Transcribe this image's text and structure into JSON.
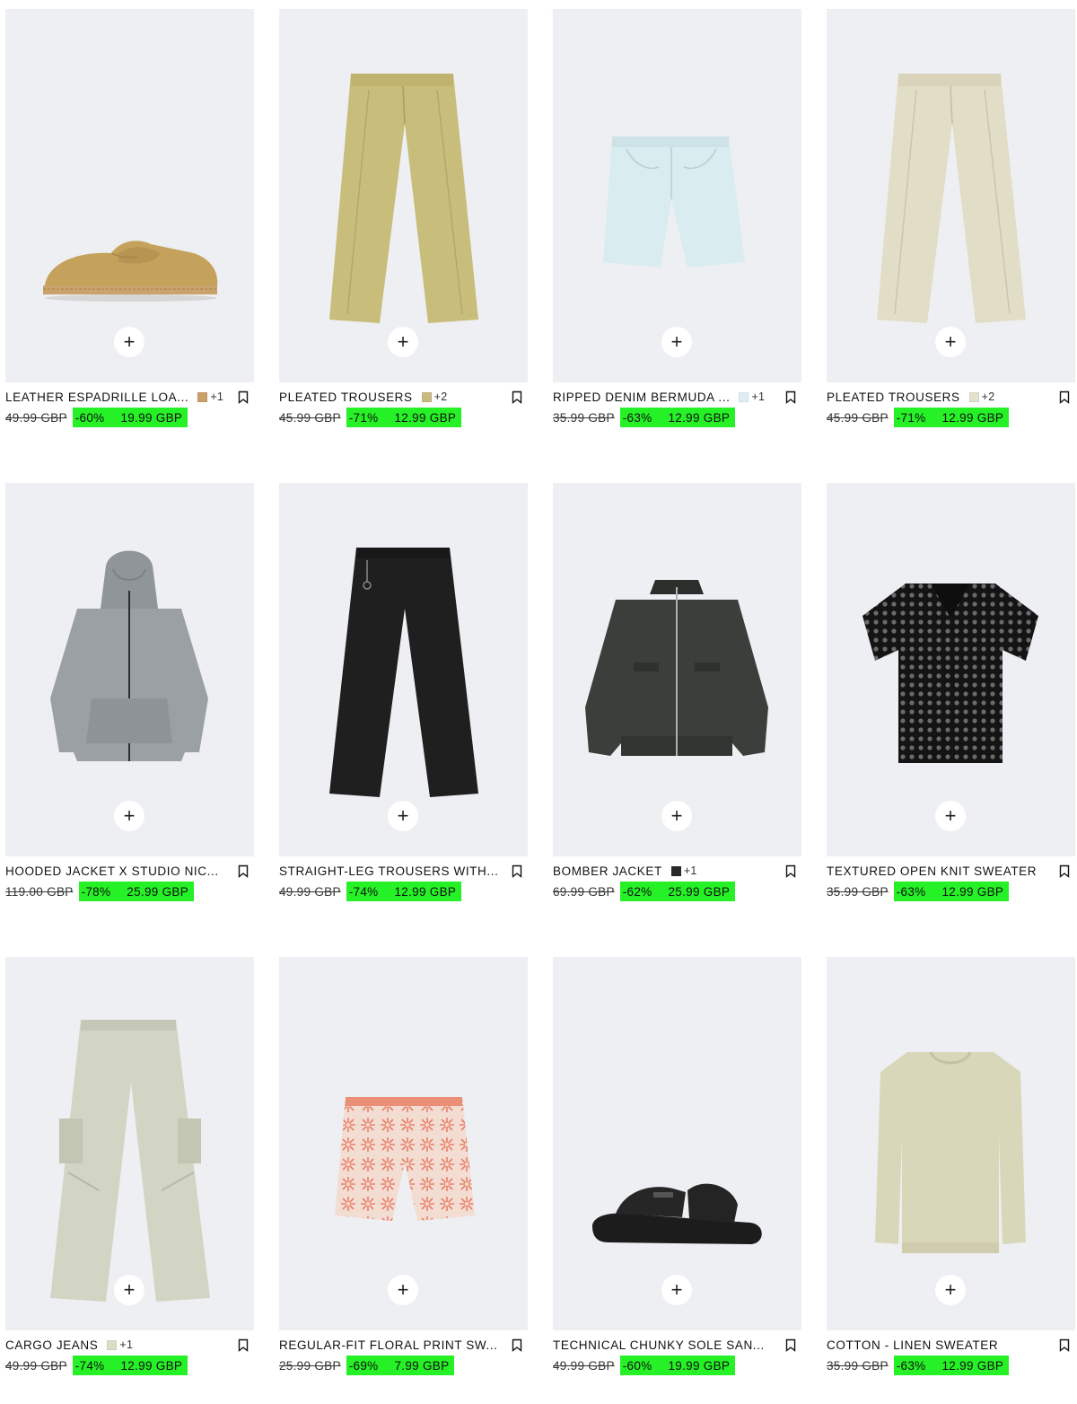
{
  "accent_color": "#26f026",
  "add_label": "+",
  "products": [
    {
      "name": "LEATHER ESPADRILLE LOA...",
      "swatch_color": "#c9a06a",
      "more_colors": "+1",
      "old_price": "49.99 GBP",
      "discount": "-60%",
      "new_price": "19.99 GBP",
      "icon": "espadrille-loafer"
    },
    {
      "name": "PLEATED TROUSERS",
      "swatch_color": "#c9bb80",
      "more_colors": "+2",
      "old_price": "45.99 GBP",
      "discount": "-71%",
      "new_price": "12.99 GBP",
      "icon": "trousers-olive"
    },
    {
      "name": "RIPPED DENIM BERMUDA ...",
      "swatch_color": "#dfeef2",
      "more_colors": "+1",
      "old_price": "35.99 GBP",
      "discount": "-63%",
      "new_price": "12.99 GBP",
      "icon": "denim-shorts"
    },
    {
      "name": "PLEATED TROUSERS",
      "swatch_color": "#e4e1cf",
      "more_colors": "+2",
      "old_price": "45.99 GBP",
      "discount": "-71%",
      "new_price": "12.99 GBP",
      "icon": "trousers-beige"
    },
    {
      "name": "HOODED JACKET X STUDIO NIC...",
      "swatch_color": "",
      "more_colors": "",
      "old_price": "119.00 GBP",
      "discount": "-78%",
      "new_price": "25.99 GBP",
      "icon": "hooded-jacket"
    },
    {
      "name": "STRAIGHT-LEG TROUSERS WITH...",
      "swatch_color": "",
      "more_colors": "",
      "old_price": "49.99 GBP",
      "discount": "-74%",
      "new_price": "12.99 GBP",
      "icon": "black-trousers"
    },
    {
      "name": "BOMBER JACKET",
      "swatch_color": "#2a2a2a",
      "more_colors": "+1",
      "old_price": "69.99 GBP",
      "discount": "-62%",
      "new_price": "25.99 GBP",
      "icon": "bomber-jacket"
    },
    {
      "name": "TEXTURED OPEN KNIT SWEATER",
      "swatch_color": "",
      "more_colors": "",
      "old_price": "35.99 GBP",
      "discount": "-63%",
      "new_price": "12.99 GBP",
      "icon": "open-knit-sweater"
    },
    {
      "name": "CARGO JEANS",
      "swatch_color": "#dcdcc8",
      "more_colors": "+1",
      "old_price": "49.99 GBP",
      "discount": "-74%",
      "new_price": "12.99 GBP",
      "icon": "cargo-jeans"
    },
    {
      "name": "REGULAR-FIT FLORAL PRINT SW...",
      "swatch_color": "",
      "more_colors": "",
      "old_price": "25.99 GBP",
      "discount": "-69%",
      "new_price": "7.99 GBP",
      "icon": "floral-shorts"
    },
    {
      "name": "TECHNICAL CHUNKY SOLE SAN...",
      "swatch_color": "",
      "more_colors": "",
      "old_price": "49.99 GBP",
      "discount": "-60%",
      "new_price": "19.99 GBP",
      "icon": "chunky-sandal"
    },
    {
      "name": "COTTON - LINEN SWEATER",
      "swatch_color": "",
      "more_colors": "",
      "old_price": "35.99 GBP",
      "discount": "-63%",
      "new_price": "12.99 GBP",
      "icon": "linen-sweater"
    }
  ]
}
